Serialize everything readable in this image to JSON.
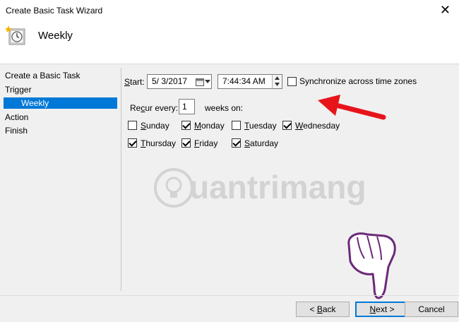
{
  "window": {
    "title": "Create Basic Task Wizard",
    "close_glyph": "✕"
  },
  "header": {
    "title": "Weekly",
    "icon": "task-clock-icon"
  },
  "sidebar": {
    "items": [
      {
        "label": "Create a Basic Task"
      },
      {
        "label": "Trigger"
      },
      {
        "label": "Weekly",
        "selected": true
      },
      {
        "label": "Action"
      },
      {
        "label": "Finish"
      }
    ]
  },
  "form": {
    "start_label_u": "S",
    "start_label_rest": "tart:",
    "start_date": "5/ 3/2017",
    "start_time": "7:44:34 AM",
    "sync_label": "Synchronize across time zones",
    "sync_checked": false,
    "recur_label_pre": "Re",
    "recur_label_u": "c",
    "recur_label_post": "ur every:",
    "recur_value": "1",
    "weeks_on": "weeks on:",
    "days": [
      {
        "u": "S",
        "rest": "unday",
        "checked": false
      },
      {
        "u": "M",
        "rest": "onday",
        "checked": true
      },
      {
        "u": "T",
        "rest": "uesday",
        "checked": false
      },
      {
        "u": "W",
        "rest": "ednesday",
        "checked": true
      },
      {
        "u": "T",
        "rest": "hursday",
        "checked": true
      },
      {
        "u": "F",
        "rest": "riday",
        "checked": true
      },
      {
        "u": "S",
        "rest": "aturday",
        "checked": true
      }
    ]
  },
  "buttons": {
    "back_pre": "< ",
    "back_u": "B",
    "back_rest": "ack",
    "next_u": "N",
    "next_rest": "ext >",
    "cancel": "Cancel"
  },
  "watermark": {
    "text": "uantrimang"
  },
  "colors": {
    "selection": "#0078d7",
    "arrow": "#e8141b",
    "hand": "#6b2a7a"
  }
}
